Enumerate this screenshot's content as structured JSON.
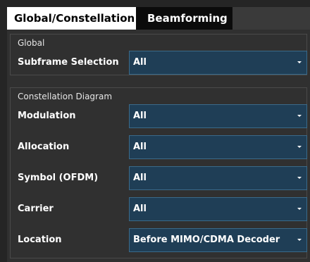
{
  "tabs": [
    {
      "label": "Global/Constellation",
      "active": true
    },
    {
      "label": "Beamforming",
      "active": false
    }
  ],
  "global": {
    "title": "Global",
    "rows": [
      {
        "label": "Subframe Selection",
        "value": "All",
        "icon": "chevron-down-icon"
      }
    ]
  },
  "constellation": {
    "title": "Constellation Diagram",
    "rows": [
      {
        "label": "Modulation",
        "value": "All",
        "icon": "chevron-down-icon"
      },
      {
        "label": "Allocation",
        "value": "All",
        "icon": "chevron-down-icon"
      },
      {
        "label": "Symbol (OFDM)",
        "value": "All",
        "icon": "chevron-down-icon"
      },
      {
        "label": "Carrier",
        "value": "All",
        "icon": "chevron-down-icon"
      },
      {
        "label": "Location",
        "value": "Before MIMO/CDMA Decoder",
        "icon": "chevron-down-icon"
      }
    ]
  },
  "colors": {
    "background": "#252525",
    "panel": "#303030",
    "dropdown": "#1f3e56",
    "active_tab": "#ffffff",
    "inactive_tab": "#0b0b0b"
  }
}
